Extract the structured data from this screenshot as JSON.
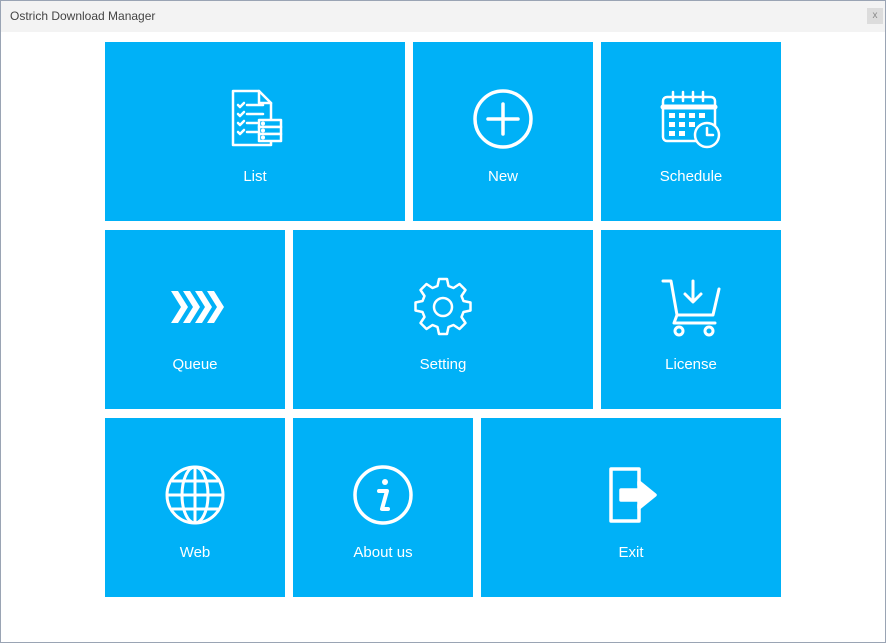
{
  "window": {
    "title": "Ostrich Download Manager",
    "close_label": "x"
  },
  "theme": {
    "tile_color": "#00b1f7",
    "text_color": "#ffffff"
  },
  "tiles": {
    "list": {
      "label": "List",
      "icon": "checklist-document-icon"
    },
    "new": {
      "label": "New",
      "icon": "plus-circle-icon"
    },
    "schedule": {
      "label": "Schedule",
      "icon": "calendar-clock-icon"
    },
    "queue": {
      "label": "Queue",
      "icon": "chevrons-right-icon"
    },
    "setting": {
      "label": "Setting",
      "icon": "gear-icon"
    },
    "license": {
      "label": "License",
      "icon": "shopping-cart-icon"
    },
    "web": {
      "label": "Web",
      "icon": "globe-icon"
    },
    "about": {
      "label": "About us",
      "icon": "info-icon"
    },
    "exit": {
      "label": "Exit",
      "icon": "exit-door-icon"
    }
  }
}
